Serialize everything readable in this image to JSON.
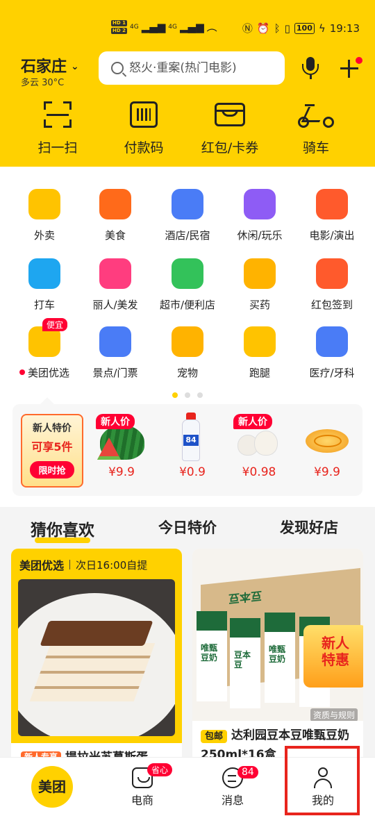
{
  "status_bar": {
    "sim": [
      "HD 1",
      "HD 2"
    ],
    "signal": [
      "4G",
      "4G"
    ],
    "battery": "100",
    "time": "19:13"
  },
  "header": {
    "city": "石家庄",
    "weather": "多云 30°C",
    "search_placeholder": "怒火·重案(热门电影)"
  },
  "quick_actions": [
    {
      "label": "扫一扫",
      "icon": "scan-icon"
    },
    {
      "label": "付款码",
      "icon": "pay-code-icon"
    },
    {
      "label": "红包/卡券",
      "icon": "coupon-wallet-icon"
    },
    {
      "label": "骑车",
      "icon": "bike-icon"
    }
  ],
  "services": [
    {
      "label": "外卖",
      "icon": "delivery-kangaroo-icon",
      "color": "#ffc300"
    },
    {
      "label": "美食",
      "icon": "fork-knife-icon",
      "color": "#ff6a1a"
    },
    {
      "label": "酒店/民宿",
      "icon": "hotel-icon",
      "color": "#4a7cf6"
    },
    {
      "label": "休闲/玩乐",
      "icon": "leisure-icon",
      "color": "#8e5cf5"
    },
    {
      "label": "电影/演出",
      "icon": "cat-movie-icon",
      "color": "#ff5a2c"
    },
    {
      "label": "打车",
      "icon": "taxi-icon",
      "color": "#1ea6f0"
    },
    {
      "label": "丽人/美发",
      "icon": "beauty-icon",
      "color": "#ff3d7f"
    },
    {
      "label": "超市/便利店",
      "icon": "grocery-basket-icon",
      "color": "#33c25a"
    },
    {
      "label": "买药",
      "icon": "medicine-box-icon",
      "color": "#ffb300"
    },
    {
      "label": "红包签到",
      "icon": "red-pouch-icon",
      "color": "#ff5a2c"
    },
    {
      "label": "美团优选",
      "icon": "youxuan-face-icon",
      "color": "#ffc300",
      "badge": "便宜",
      "dot": true
    },
    {
      "label": "景点/门票",
      "icon": "temple-icon",
      "color": "#4a7cf6"
    },
    {
      "label": "宠物",
      "icon": "dog-icon",
      "color": "#ffb300"
    },
    {
      "label": "跑腿",
      "icon": "runner-icon",
      "color": "#ffc300"
    },
    {
      "label": "医疗/牙科",
      "icon": "medical-cross-icon",
      "color": "#4a7cf6"
    }
  ],
  "promo": {
    "card_title": "新人特价",
    "card_sub": "可享5件",
    "card_button": "限时抢",
    "products": [
      {
        "tag": "新人价",
        "price": "¥9.9",
        "icon": "watermelon-icon"
      },
      {
        "tag": "",
        "price": "¥0.9",
        "icon": "bleach-bottle-icon"
      },
      {
        "tag": "新人价",
        "price": "¥0.98",
        "icon": "garlic-icon"
      },
      {
        "tag": "",
        "price": "¥9.9",
        "icon": "dried-fruit-icon"
      }
    ]
  },
  "feed_tabs": [
    "猜你喜欢",
    "今日特价",
    "发现好店"
  ],
  "card_left": {
    "brand": "美团优选",
    "pickup": "次日16:00自提",
    "tag": "新人专享",
    "title": "提拉米苏慕斯蛋"
  },
  "card_right": {
    "box_brand": "豆本豆",
    "carton_text": [
      "豆本豆",
      "唯甄豆奶"
    ],
    "newbie": [
      "新人",
      "特惠"
    ],
    "quality": "资质与规则",
    "tag": "包邮",
    "title": "达利园豆本豆唯甄豆奶250ml*16盒"
  },
  "bottom_nav": {
    "home": "美团",
    "shop": "电商",
    "shop_badge": "省心",
    "msg": "消息",
    "msg_badge": "84",
    "me": "我的"
  }
}
